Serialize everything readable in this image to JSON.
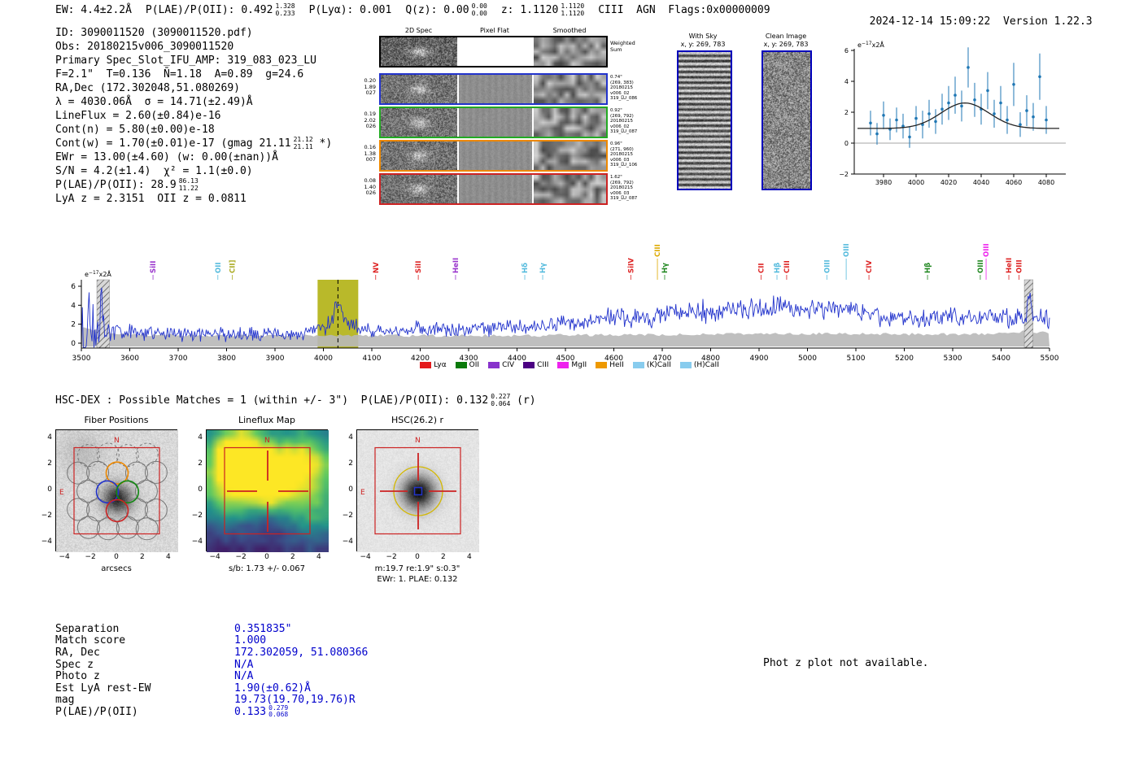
{
  "header": {
    "segments": [
      {
        "text": "EW: 4.4±2.2Å"
      },
      {
        "text": "P(LAE)/P(OII): 0.492",
        "sup": "1.328",
        "sub": "0.233"
      },
      {
        "text": "P(Lyα): 0.001"
      },
      {
        "text": "Q(z): 0.00",
        "sup": "0.00",
        "sub": "0.00"
      },
      {
        "text": "z: 1.1120",
        "sup": "1.1120",
        "sub": "1.1120"
      },
      {
        "text": "CIII  AGN  Flags:0x00000009"
      }
    ],
    "timestamp": "2024-12-14 15:09:22",
    "version": "Version 1.22.3"
  },
  "info_block": {
    "lines": [
      {
        "text": "ID: 3090011520 (3090011520.pdf)"
      },
      {
        "text": "Obs: 20180215v006_3090011520"
      },
      {
        "text": "Primary Spec_Slot_IFU_AMP: 319_083_023_LU"
      },
      {
        "text": "F=2.1\"  T=0.136  N̄=1.18  A=0.89  g=24.6"
      },
      {
        "text": "RA,Dec (172.302048,51.080269)"
      },
      {
        "text": "λ = 4030.06Å  σ = 14.71(±2.49)Å"
      },
      {
        "text": "LineFlux = 2.60(±0.84)e-16"
      },
      {
        "text": "Cont(n) = 5.80(±0.00)e-18"
      },
      {
        "text": "Cont(w) = 1.70(±0.01)e-17 (gmag 21.11",
        "sup": "21.12",
        "sub": "21.11",
        "tail": " *)"
      },
      {
        "text": "EWr = 13.00(±4.60) (w: 0.00(±nan))Å"
      },
      {
        "text": "S/N = 4.2(±1.4)  χ² = 1.1(±0.0)"
      },
      {
        "text": "P(LAE)/P(OII): 28.9",
        "sup": "86.13",
        "sub": "11.22"
      },
      {
        "text": "LyA z = 2.3151  OII z = 0.0811"
      }
    ]
  },
  "cutouts2d": {
    "col_headers": [
      "2D Spec",
      "Pixel Flat",
      "Smoothed"
    ],
    "weighted_label": [
      "Weighted",
      "Sum"
    ],
    "rows": [
      {
        "border": "#2233cc",
        "left_label": [
          "0.20",
          "1.89",
          "027"
        ],
        "right_label": [
          "0.74\"",
          "(269, 383)",
          "20180215",
          "v006_02",
          "319_LU_086"
        ]
      },
      {
        "border": "#22aa22",
        "left_label": [
          "0.19",
          "2.02",
          "026"
        ],
        "right_label": [
          "0.92\"",
          "(269, 792)",
          "20180215",
          "v006_02",
          "319_LU_087"
        ]
      },
      {
        "border": "#ee8800",
        "left_label": [
          "0.16",
          "1.38",
          "007"
        ],
        "right_label": [
          "0.96\"",
          "(271, 960)",
          "20180215",
          "v006_03",
          "319_LU_106"
        ]
      },
      {
        "border": "#cc2222",
        "left_label": [
          "0.08",
          "1.40",
          "026"
        ],
        "right_label": [
          "1.62\"",
          "(269, 792)",
          "20180215",
          "v006_03",
          "319_LU_087"
        ]
      }
    ]
  },
  "sky_panels": {
    "with_sky": {
      "title": "With Sky",
      "coords": "x, y: 269, 783"
    },
    "clean": {
      "title": "Clean Image",
      "coords": "x, y: 269, 783"
    }
  },
  "hsc_header": {
    "pre": "HSC-DEX : Possible Matches = 1 (within +/- 3\")  P(LAE)/P(OII): 0.132",
    "sup": "0.227",
    "sub": "0.064",
    "post": " (r)"
  },
  "cutouts": {
    "ticks": [
      "−4",
      "−2",
      "0",
      "2",
      "4"
    ],
    "fiber": {
      "title": "Fiber Positions",
      "xlabel": "arcsecs",
      "north": "N",
      "east": "E"
    },
    "lineflux": {
      "title": "Lineflux Map",
      "caption": "s/b: 1.73 +/- 0.067",
      "north": "N"
    },
    "hsc": {
      "title": "HSC(26.2) r",
      "caption1": "m:19.7 re:1.9\" s:0.3\"",
      "caption2": "EWr: 1. PLAE: 0.132",
      "north": "N",
      "east": "E"
    }
  },
  "match_table": {
    "rows": [
      {
        "label": "Separation",
        "value": "0.351835\""
      },
      {
        "label": "Match score",
        "value": "1.000"
      },
      {
        "label": "RA, Dec",
        "value": "172.302059, 51.080366"
      },
      {
        "label": "Spec z",
        "value": "N/A"
      },
      {
        "label": "Photo z",
        "value": "N/A"
      },
      {
        "label": "Est LyA rest-EW",
        "value": "1.90(±0.62)Å"
      },
      {
        "label": "mag",
        "value": "19.73(19.70,19.76)R"
      },
      {
        "label": "P(LAE)/P(OII)",
        "value": "0.133",
        "sup": "0.279",
        "sub": "0.068"
      }
    ]
  },
  "photz_note": "Phot z plot not available.",
  "chart_data": [
    {
      "type": "scatter",
      "title": "",
      "ylabel_parts": {
        "base": "e",
        "exp": "−17",
        "rest": "x2Å"
      },
      "xlim": [
        3962,
        4090
      ],
      "ylim": [
        -2,
        6
      ],
      "xticks": [
        3980,
        4000,
        4020,
        4040,
        4060,
        4080
      ],
      "xtick_labels": [
        "3980",
        "4000",
        "4020",
        "4040",
        "4060",
        "4080"
      ],
      "yticks": [
        -2,
        0,
        2,
        4,
        6
      ],
      "ytick_labels": [
        "−2",
        "0",
        "2",
        "4",
        "6"
      ],
      "x": [
        3972,
        3976,
        3980,
        3984,
        3988,
        3992,
        3996,
        4000,
        4004,
        4008,
        4012,
        4016,
        4020,
        4024,
        4028,
        4032,
        4036,
        4040,
        4044,
        4048,
        4052,
        4056,
        4060,
        4064,
        4068,
        4072,
        4076,
        4080
      ],
      "y": [
        1.3,
        0.6,
        1.8,
        0.9,
        1.5,
        1.1,
        0.4,
        1.6,
        1.2,
        1.9,
        1.4,
        2.2,
        2.6,
        3.1,
        2.4,
        4.9,
        2.8,
        2.2,
        3.4,
        1.9,
        2.6,
        1.5,
        3.8,
        1.2,
        2.1,
        1.7,
        4.3,
        1.5
      ],
      "yerr": [
        0.8,
        0.7,
        0.9,
        0.7,
        0.8,
        0.8,
        0.7,
        0.8,
        0.9,
        0.9,
        0.8,
        1.0,
        1.1,
        1.2,
        1.0,
        1.3,
        1.1,
        1.0,
        1.2,
        0.9,
        1.1,
        0.9,
        1.4,
        0.8,
        1.0,
        0.9,
        1.5,
        0.9
      ],
      "fit": {
        "shape": "gaussian",
        "mu": 4030.06,
        "sigma": 14.71,
        "amplitude": 1.65,
        "offset": 0.95
      }
    },
    {
      "type": "line",
      "title": "",
      "ylabel_parts": {
        "base": "e",
        "exp": "−17",
        "rest": "x2Å"
      },
      "xlim": [
        3470,
        5540
      ],
      "ylim": [
        -0.5,
        6.5
      ],
      "xticks": [
        3500,
        3600,
        3700,
        3800,
        3900,
        4000,
        4100,
        4200,
        4300,
        4400,
        4500,
        4600,
        4700,
        4800,
        4900,
        5000,
        5100,
        5200,
        5300,
        5400,
        5500
      ],
      "xtick_labels": [
        "3500",
        "3600",
        "3700",
        "3800",
        "3900",
        "4000",
        "4100",
        "4200",
        "4300",
        "4400",
        "4500",
        "4600",
        "4700",
        "4800",
        "4900",
        "5000",
        "5100",
        "5200",
        "5300",
        "5400",
        "5500"
      ],
      "yticks": [
        0,
        2,
        4,
        6
      ],
      "ytick_labels": [
        "0",
        "2",
        "4",
        "6"
      ],
      "line_center": 4030.06,
      "highlight_band": [
        3988,
        4072
      ],
      "masked_bands": [
        [
          3532,
          3558
        ],
        [
          5448,
          5466
        ]
      ],
      "envelope_x": [
        3500,
        3550,
        3600,
        3650,
        3700,
        3750,
        3800,
        3850,
        3900,
        3950,
        4000,
        4050,
        4100,
        4150,
        4200,
        4250,
        4300,
        4350,
        4400,
        4450,
        4500,
        4550,
        4600,
        4650,
        4700,
        4750,
        4800,
        4850,
        4900,
        4950,
        5000,
        5050,
        5100,
        5150,
        5200,
        5250,
        5300,
        5350,
        5400,
        5450,
        5500
      ],
      "envelope_y": [
        1.4,
        1.0,
        1.2,
        1.0,
        1.1,
        0.9,
        1.0,
        0.9,
        1.0,
        0.9,
        1.6,
        1.9,
        1.2,
        1.3,
        1.5,
        1.4,
        1.6,
        1.5,
        1.7,
        1.8,
        2.2,
        2.4,
        2.8,
        2.6,
        3.0,
        3.2,
        3.4,
        3.3,
        3.6,
        3.8,
        3.6,
        3.8,
        3.4,
        2.7,
        2.8,
        2.6,
        2.8,
        2.6,
        2.8,
        2.4,
        2.6
      ],
      "envelope_amp": [
        2.0,
        1.2,
        1.1,
        1.0,
        1.0,
        0.9,
        0.9,
        0.9,
        0.9,
        0.9,
        1.1,
        1.1,
        0.9,
        0.9,
        1.0,
        0.9,
        1.0,
        0.9,
        1.0,
        1.0,
        1.1,
        1.1,
        1.3,
        1.2,
        1.3,
        1.3,
        1.4,
        1.3,
        1.4,
        1.4,
        1.4,
        1.4,
        1.3,
        1.1,
        1.1,
        1.1,
        1.1,
        1.1,
        1.1,
        1.3,
        1.2
      ],
      "err_band": [
        1.7,
        1.1,
        0.9,
        0.85,
        0.85,
        0.8,
        0.8,
        0.8,
        0.8,
        0.8,
        0.85,
        0.85,
        0.8,
        0.8,
        0.8,
        0.8,
        0.8,
        0.8,
        0.8,
        0.8,
        0.85,
        0.85,
        0.9,
        0.9,
        0.9,
        0.9,
        0.95,
        0.95,
        0.95,
        0.95,
        1.0,
        1.0,
        1.0,
        0.95,
        0.95,
        0.95,
        0.95,
        0.95,
        1.0,
        1.2,
        1.05
      ],
      "line_labels": [
        {
          "label": "SiII",
          "wave": 3648,
          "color": "#9933cc",
          "row": 0
        },
        {
          "label": "OII",
          "wave": 3782,
          "color": "#55bbdd",
          "row": 0
        },
        {
          "label": "CII]",
          "wave": 3812,
          "color": "#aaaa22",
          "row": 0
        },
        {
          "label": "NV",
          "wave": 4108,
          "color": "#dd2222",
          "row": 0
        },
        {
          "label": "SiII",
          "wave": 4196,
          "color": "#dd2222",
          "row": 0
        },
        {
          "label": "HeII",
          "wave": 4273,
          "color": "#9933cc",
          "row": 0
        },
        {
          "label": "Hδ",
          "wave": 4416,
          "color": "#55bbdd",
          "row": 0
        },
        {
          "label": "Hγ",
          "wave": 4453,
          "color": "#55bbdd",
          "row": 0
        },
        {
          "label": "SiIV",
          "wave": 4635,
          "color": "#dd2222",
          "row": 0
        },
        {
          "label": "CIII",
          "wave": 4690,
          "color": "#ddaa00",
          "row": 1
        },
        {
          "label": "Hγ",
          "wave": 4705,
          "color": "#228822",
          "row": 0
        },
        {
          "label": "CII",
          "wave": 4904,
          "color": "#dd2222",
          "row": 0
        },
        {
          "label": "Hβ",
          "wave": 4937,
          "color": "#55bbdd",
          "row": 0
        },
        {
          "label": "CIII",
          "wave": 4957,
          "color": "#dd2222",
          "row": 0
        },
        {
          "label": "OIII",
          "wave": 5040,
          "color": "#55bbdd",
          "row": 0
        },
        {
          "label": "OIII",
          "wave": 5080,
          "color": "#55bbdd",
          "row": 1
        },
        {
          "label": "CIV",
          "wave": 5127,
          "color": "#dd2222",
          "row": 0
        },
        {
          "label": "Hβ",
          "wave": 5248,
          "color": "#228822",
          "row": 0
        },
        {
          "label": "OIII",
          "wave": 5357,
          "color": "#228822",
          "row": 0
        },
        {
          "label": "OIII",
          "wave": 5369,
          "color": "#ee22ee",
          "row": 1
        },
        {
          "label": "HeII",
          "wave": 5416,
          "color": "#dd2222",
          "row": 0
        },
        {
          "label": "OIII",
          "wave": 5437,
          "color": "#dd2222",
          "row": 0
        }
      ],
      "legend": [
        {
          "label": "Lyα",
          "color": "#e41a1c"
        },
        {
          "label": "OII",
          "color": "#0a7a0a"
        },
        {
          "label": "CIV",
          "color": "#8833cc"
        },
        {
          "label": "CIII",
          "color": "#4b0082"
        },
        {
          "label": "MgII",
          "color": "#ee22ee"
        },
        {
          "label": "HeII",
          "color": "#ee9900"
        },
        {
          "label": "(K)CaII",
          "color": "#88ccee"
        },
        {
          "label": "(H)CaII",
          "color": "#88ccee"
        }
      ]
    }
  ]
}
